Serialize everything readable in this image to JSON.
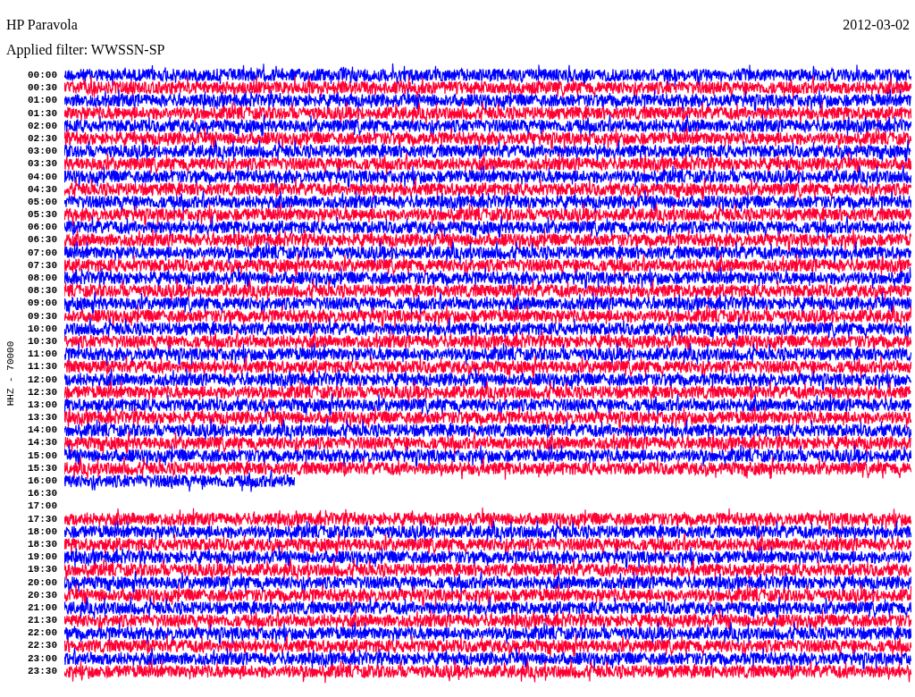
{
  "title": "HP Paravola",
  "date": "2012-03-02",
  "filter": "Applied filter: WWSSN-SP",
  "axis_label": "HHZ - 70000",
  "rows": [
    {
      "time": "00:00",
      "color": "#0000ff",
      "kind": "trace"
    },
    {
      "time": "00:30",
      "color": "#ff0033",
      "kind": "trace"
    },
    {
      "time": "01:00",
      "color": "#0000ff",
      "kind": "trace"
    },
    {
      "time": "01:30",
      "color": "#ff0033",
      "kind": "trace"
    },
    {
      "time": "02:00",
      "color": "#0000ff",
      "kind": "trace"
    },
    {
      "time": "02:30",
      "color": "#ff0033",
      "kind": "trace"
    },
    {
      "time": "03:00",
      "color": "#0000ff",
      "kind": "trace"
    },
    {
      "time": "03:30",
      "color": "#ff0033",
      "kind": "trace"
    },
    {
      "time": "04:00",
      "color": "#0000ff",
      "kind": "trace"
    },
    {
      "time": "04:30",
      "color": "#ff0033",
      "kind": "trace"
    },
    {
      "time": "05:00",
      "color": "#0000ff",
      "kind": "trace"
    },
    {
      "time": "05:30",
      "color": "#ff0033",
      "kind": "trace"
    },
    {
      "time": "06:00",
      "color": "#0000ff",
      "kind": "trace"
    },
    {
      "time": "06:30",
      "color": "#ff0033",
      "kind": "trace"
    },
    {
      "time": "07:00",
      "color": "#0000ff",
      "kind": "trace"
    },
    {
      "time": "07:30",
      "color": "#ff0033",
      "kind": "trace"
    },
    {
      "time": "08:00",
      "color": "#0000ff",
      "kind": "trace"
    },
    {
      "time": "08:30",
      "color": "#ff0033",
      "kind": "trace"
    },
    {
      "time": "09:00",
      "color": "#0000ff",
      "kind": "trace"
    },
    {
      "time": "09:30",
      "color": "#ff0033",
      "kind": "trace"
    },
    {
      "time": "10:00",
      "color": "#0000ff",
      "kind": "trace"
    },
    {
      "time": "10:30",
      "color": "#ff0033",
      "kind": "trace"
    },
    {
      "time": "11:00",
      "color": "#0000ff",
      "kind": "trace"
    },
    {
      "time": "11:30",
      "color": "#ff0033",
      "kind": "trace"
    },
    {
      "time": "12:00",
      "color": "#0000ff",
      "kind": "trace"
    },
    {
      "time": "12:30",
      "color": "#ff0033",
      "kind": "trace"
    },
    {
      "time": "13:00",
      "color": "#0000ff",
      "kind": "trace"
    },
    {
      "time": "13:30",
      "color": "#ff0033",
      "kind": "trace"
    },
    {
      "time": "14:00",
      "color": "#0000ff",
      "kind": "trace"
    },
    {
      "time": "14:30",
      "color": "#ff0033",
      "kind": "trace"
    },
    {
      "time": "15:00",
      "color": "#0000ff",
      "kind": "trace"
    },
    {
      "time": "15:30",
      "color": "#ff0033",
      "kind": "trace"
    },
    {
      "time": "16:00",
      "color": "#0000ff",
      "kind": "partial"
    },
    {
      "time": "16:30",
      "kind": "empty"
    },
    {
      "time": "17:00",
      "kind": "empty"
    },
    {
      "time": "17:30",
      "color": "#ff0033",
      "kind": "trace"
    },
    {
      "time": "18:00",
      "color": "#0000ff",
      "kind": "trace"
    },
    {
      "time": "18:30",
      "color": "#ff0033",
      "kind": "trace"
    },
    {
      "time": "19:00",
      "color": "#0000ff",
      "kind": "trace"
    },
    {
      "time": "19:30",
      "color": "#ff0033",
      "kind": "trace"
    },
    {
      "time": "20:00",
      "color": "#0000ff",
      "kind": "trace"
    },
    {
      "time": "20:30",
      "color": "#ff0033",
      "kind": "trace"
    },
    {
      "time": "21:00",
      "color": "#0000ff",
      "kind": "trace"
    },
    {
      "time": "21:30",
      "color": "#ff0033",
      "kind": "trace"
    },
    {
      "time": "22:00",
      "color": "#0000ff",
      "kind": "trace"
    },
    {
      "time": "22:30",
      "color": "#ff0033",
      "kind": "trace"
    },
    {
      "time": "23:00",
      "color": "#0000ff",
      "kind": "trace"
    },
    {
      "time": "23:30",
      "color": "#ff0033",
      "kind": "trace"
    }
  ]
}
